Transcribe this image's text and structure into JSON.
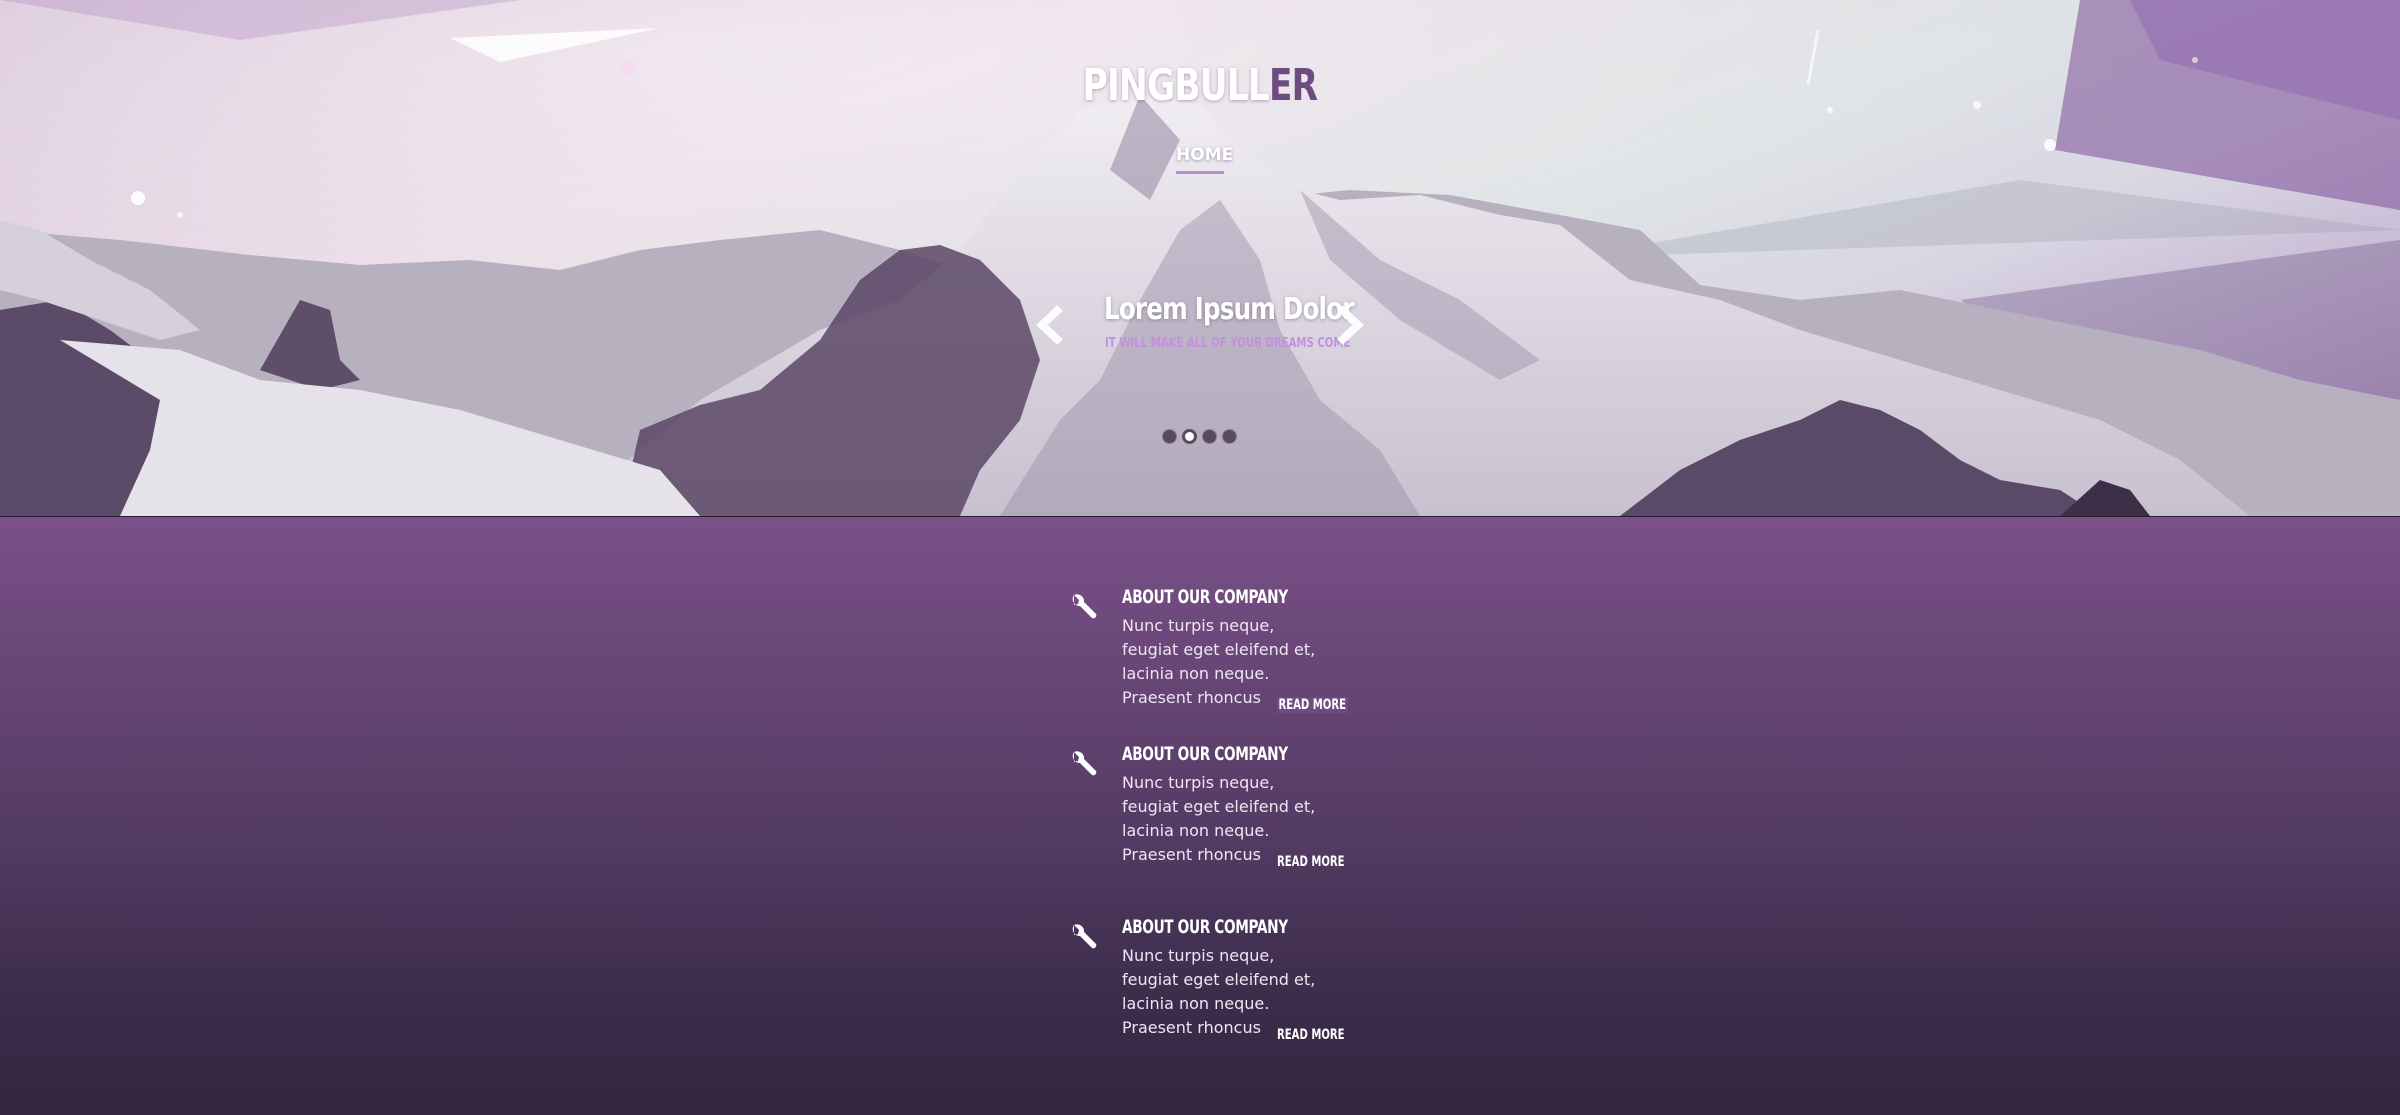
{
  "brand": {
    "logo_main": "PINGBULL",
    "logo_accent": "ER",
    "accent_color": "#6e4c7e"
  },
  "nav": {
    "items": [
      {
        "label": "HOME",
        "active": true
      }
    ]
  },
  "slider": {
    "title": "Lorem Ipsum Dolor",
    "subtitle": "IT WILL MAKE ALL OF YOUR DREAMS COME",
    "prev_icon": "chevron-left-icon",
    "next_icon": "chevron-right-icon",
    "dots": 4,
    "active_dot": 2
  },
  "features": [
    {
      "icon": "wrench-icon",
      "title": "ABOUT OUR COMPANY",
      "text": "Nunc turpis neque, feugiat eget eleifend et, lacinia non neque. Praesent rhoncus",
      "more": "READ MORE"
    },
    {
      "icon": "wrench-icon",
      "title": "ABOUT OUR COMPANY",
      "text": "Nunc turpis neque, feugiat eget eleifend et, lacinia non neque. Praesent rhoncus",
      "more": "READ MORE"
    },
    {
      "icon": "wrench-icon",
      "title": "ABOUT OUR COMPANY",
      "text": "Nunc turpis neque, feugiat eget eleifend et, lacinia non neque. Praesent rhoncus",
      "more": "READ MORE"
    }
  ],
  "colors": {
    "content_top": "#7a5188",
    "content_bottom": "#33253f",
    "subtitle": "#c58fe0"
  }
}
